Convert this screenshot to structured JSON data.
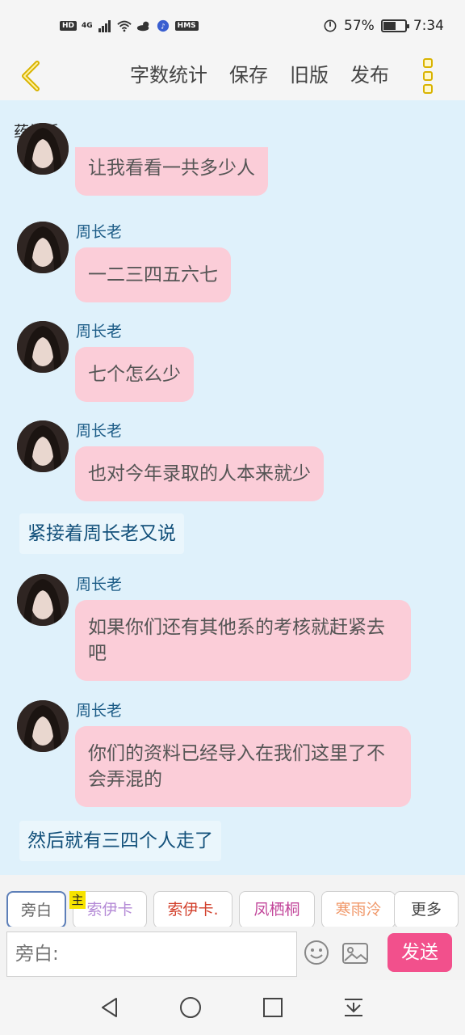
{
  "status_bar": {
    "hd_badge": "HD",
    "network": "4G",
    "hms_badge": "HMS",
    "battery_percent": "57%",
    "battery_level": 0.57,
    "time": "7:34"
  },
  "nav": {
    "actions": [
      "字数统计",
      "保存",
      "旧版",
      "发布"
    ],
    "back_icon": "chevron-left-icon",
    "more_icon": "more-dots-icon"
  },
  "chat": {
    "title": "药学系",
    "messages": [
      {
        "type": "bubble",
        "sender": "",
        "text": "让我看看一共多少人"
      },
      {
        "type": "bubble",
        "sender": "周长老",
        "text": "一二三四五六七"
      },
      {
        "type": "bubble",
        "sender": "周长老",
        "text": "七个怎么少"
      },
      {
        "type": "bubble",
        "sender": "周长老",
        "text": "也对今年录取的人本来就少"
      },
      {
        "type": "narration",
        "text": "紧接着周长老又说"
      },
      {
        "type": "bubble",
        "sender": "周长老",
        "text": "如果你们还有其他系的考核就赶紧去吧"
      },
      {
        "type": "bubble",
        "sender": "周长老",
        "text": "你们的资料已经导入在我们这里了不会弄混的"
      },
      {
        "type": "narration",
        "text": "然后就有三四个人走了"
      }
    ]
  },
  "roles": [
    {
      "label": "旁白",
      "color": "#666666",
      "active": true
    },
    {
      "label": "索伊卡",
      "color": "#b48ad6",
      "active": false
    },
    {
      "label": "索伊卡.",
      "color": "#d2402c",
      "active": false
    },
    {
      "label": "凤栖桐",
      "color": "#c2469a",
      "active": false
    },
    {
      "label": "寒雨泠",
      "color": "#f0986a",
      "active": false
    },
    {
      "label": "更多",
      "color": "#444444",
      "active": false
    }
  ],
  "owner_tag": "主",
  "input": {
    "placeholder": "旁白:",
    "send_label": "发送"
  },
  "colors": {
    "chat_bg": "#dff1fb",
    "bubble_bg": "#fbcdd8",
    "send_bg": "#f2508c",
    "sender_color": "#1b5b86"
  }
}
